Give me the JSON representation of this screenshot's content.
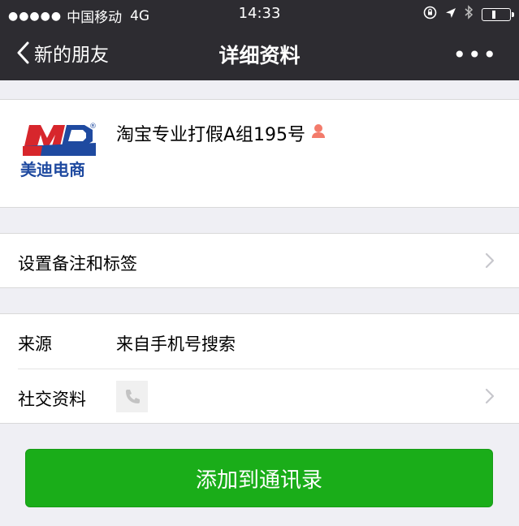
{
  "status_bar": {
    "signal": "●●●●●",
    "carrier": "中国移动",
    "network": "4G",
    "time": "14:33"
  },
  "nav": {
    "back_label": "新的朋友",
    "title": "详细资料",
    "more": "•••"
  },
  "profile": {
    "name": "淘宝专业打假A组195号",
    "logo_text_top": "MD",
    "logo_text_bottom": "美迪电商",
    "logo_registered": "®"
  },
  "remark_row": {
    "label": "设置备注和标签"
  },
  "info_rows": [
    {
      "label": "来源",
      "value": "来自手机号搜索"
    },
    {
      "label": "社交资料"
    }
  ],
  "actions": {
    "add_button": "添加到通讯录"
  },
  "colors": {
    "navbar": "#2d2c31",
    "background": "#efeff4",
    "button_green": "#1aad19",
    "logo_red": "#d7262c",
    "logo_blue": "#1f4aa0",
    "gender_female": "#f37b6b"
  }
}
